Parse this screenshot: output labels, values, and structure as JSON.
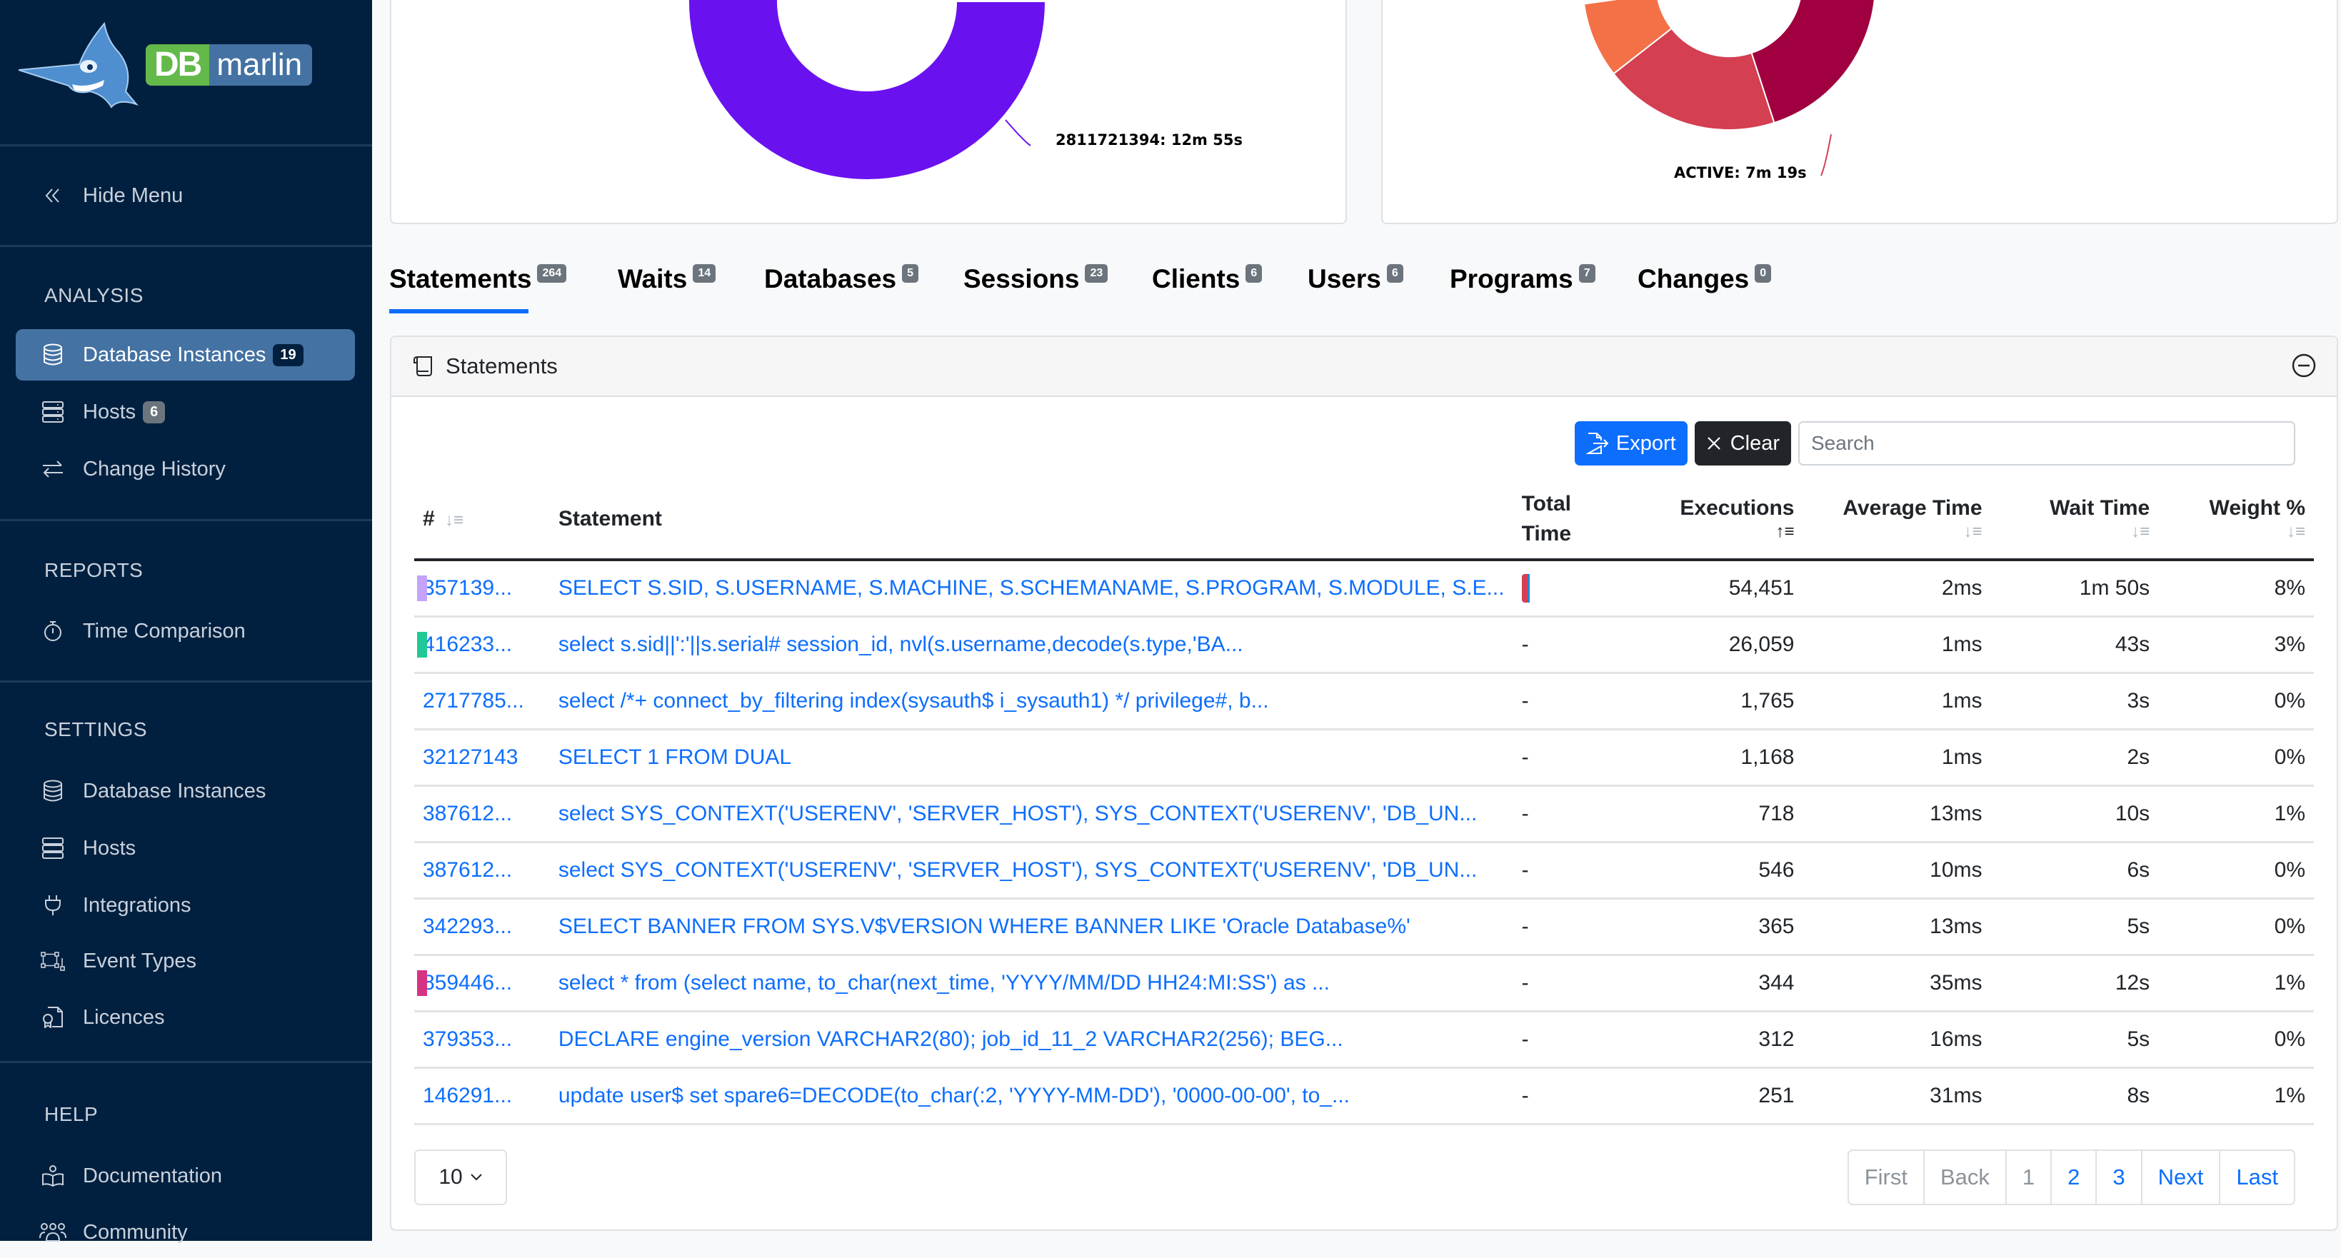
{
  "brand": {
    "logo_left": "DB",
    "logo_right": "marlin"
  },
  "sidebar": {
    "hide_menu": "Hide Menu",
    "sections": {
      "analysis": "ANALYSIS",
      "reports": "REPORTS",
      "settings": "SETTINGS",
      "help": "HELP"
    },
    "analysis_items": [
      {
        "label": "Database Instances",
        "badge": "19",
        "icon": "database-icon",
        "active": true
      },
      {
        "label": "Hosts",
        "badge": "6",
        "icon": "server-icon"
      },
      {
        "label": "Change History",
        "icon": "arrows-exchange-icon"
      }
    ],
    "reports_items": [
      {
        "label": "Time Comparison",
        "icon": "stopwatch-icon"
      }
    ],
    "settings_items": [
      {
        "label": "Database Instances",
        "icon": "database-icon"
      },
      {
        "label": "Hosts",
        "icon": "server-icon"
      },
      {
        "label": "Integrations",
        "icon": "plug-icon"
      },
      {
        "label": "Event Types",
        "icon": "diagram-icon"
      },
      {
        "label": "Licences",
        "icon": "certificate-icon"
      }
    ],
    "help_items": [
      {
        "label": "Documentation",
        "icon": "book-reader-icon"
      },
      {
        "label": "Community",
        "icon": "people-icon"
      }
    ]
  },
  "charts": {
    "left": {
      "label": "2811721394: 12m 55s",
      "colors": {
        "main": "#6a11f0",
        "light": "#c4a3fb"
      }
    },
    "right": {
      "label": "ACTIVE: 7m 19s",
      "colors": {
        "active": "#d43f51",
        "dark": "#a0003f",
        "orange": "#f47147"
      }
    }
  },
  "tabs": [
    {
      "label": "Statements",
      "count": "264",
      "active": true
    },
    {
      "label": "Waits",
      "count": "14"
    },
    {
      "label": "Databases",
      "count": "5"
    },
    {
      "label": "Sessions",
      "count": "23"
    },
    {
      "label": "Clients",
      "count": "6"
    },
    {
      "label": "Users",
      "count": "6"
    },
    {
      "label": "Programs",
      "count": "7"
    },
    {
      "label": "Changes",
      "count": "0"
    }
  ],
  "statements_card": {
    "title": "Statements",
    "export_label": "Export",
    "clear_label": "Clear",
    "search_placeholder": "Search",
    "search_value": "",
    "columns": {
      "id": "#",
      "statement": "Statement",
      "total_time_1": "Total",
      "total_time_2": "Time",
      "executions": "Executions",
      "average_time": "Average Time",
      "wait_time": "Wait Time",
      "weight": "Weight %"
    },
    "rows": [
      {
        "id": "357139...",
        "statement": "SELECT S.SID, S.USERNAME, S.MACHINE, S.SCHEMANAME, S.PROGRAM, S.MODULE, S.E...",
        "total_time": "bar",
        "executions": "54,451",
        "average_time": "2ms",
        "wait_time": "1m 50s",
        "weight": "8%",
        "color": "#c4a3fb"
      },
      {
        "id": "416233...",
        "statement": "select s.sid||':'||s.serial# session_id, nvl(s.username,decode(s.type,'BA...",
        "total_time": "-",
        "executions": "26,059",
        "average_time": "1ms",
        "wait_time": "43s",
        "weight": "3%",
        "color": "#20c997"
      },
      {
        "id": "2717785...",
        "statement": "select /*+ connect_by_filtering index(sysauth$ i_sysauth1) */ privilege#, b...",
        "total_time": "-",
        "executions": "1,765",
        "average_time": "1ms",
        "wait_time": "3s",
        "weight": "0%",
        "color": ""
      },
      {
        "id": "32127143",
        "statement": "SELECT 1 FROM DUAL",
        "total_time": "-",
        "executions": "1,168",
        "average_time": "1ms",
        "wait_time": "2s",
        "weight": "0%",
        "color": ""
      },
      {
        "id": "387612...",
        "statement": "select SYS_CONTEXT('USERENV', 'SERVER_HOST'), SYS_CONTEXT('USERENV', 'DB_UN...",
        "total_time": "-",
        "executions": "718",
        "average_time": "13ms",
        "wait_time": "10s",
        "weight": "1%",
        "color": ""
      },
      {
        "id": "387612...",
        "statement": "select SYS_CONTEXT('USERENV', 'SERVER_HOST'), SYS_CONTEXT('USERENV', 'DB_UN...",
        "total_time": "-",
        "executions": "546",
        "average_time": "10ms",
        "wait_time": "6s",
        "weight": "0%",
        "color": ""
      },
      {
        "id": "342293...",
        "statement": "SELECT BANNER FROM SYS.V$VERSION WHERE BANNER LIKE 'Oracle Database%'",
        "total_time": "-",
        "executions": "365",
        "average_time": "13ms",
        "wait_time": "5s",
        "weight": "0%",
        "color": ""
      },
      {
        "id": "859446...",
        "statement": "select * from (select name, to_char(next_time, 'YYYY/MM/DD HH24:MI:SS') as ...",
        "total_time": "-",
        "executions": "344",
        "average_time": "35ms",
        "wait_time": "12s",
        "weight": "1%",
        "color": "#d63384"
      },
      {
        "id": "379353...",
        "statement": "DECLARE engine_version VARCHAR2(80); job_id_11_2 VARCHAR2(256); BEG...",
        "total_time": "-",
        "executions": "312",
        "average_time": "16ms",
        "wait_time": "5s",
        "weight": "0%",
        "color": ""
      },
      {
        "id": "146291...",
        "statement": "update user$ set spare6=DECODE(to_char(:2, 'YYYY-MM-DD'), '0000-00-00', to_...",
        "total_time": "-",
        "executions": "251",
        "average_time": "31ms",
        "wait_time": "8s",
        "weight": "1%",
        "color": ""
      }
    ],
    "page_size": "10",
    "pagination": {
      "first": "First",
      "back": "Back",
      "pages": [
        "1",
        "2",
        "3"
      ],
      "current_page": "1",
      "next": "Next",
      "last": "Last"
    }
  }
}
